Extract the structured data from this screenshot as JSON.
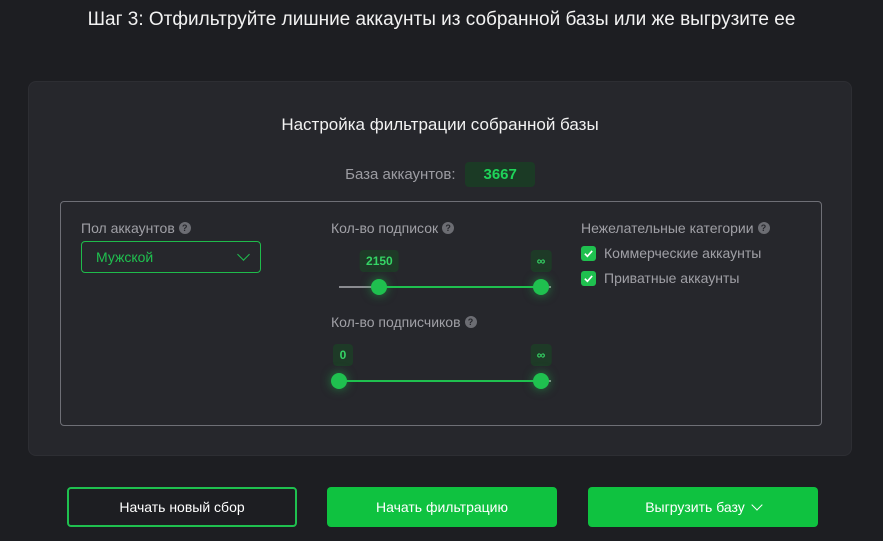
{
  "step_title": "Шаг 3: Отфильтруйте лишние аккаунты из собранной базы или же выгрузите ее",
  "card": {
    "title": "Настройка фильтрации собранной базы",
    "base_label": "База аккаунтов:",
    "base_count": "3667"
  },
  "filters": {
    "gender": {
      "label": "Пол аккаунтов",
      "help": "?",
      "selected": "Мужской"
    },
    "following": {
      "label": "Кол-во подписок",
      "help": "?",
      "min": "2150",
      "max": "∞",
      "min_pos": 0.2,
      "max_pos": 1.0
    },
    "followers": {
      "label": "Кол-во подписчиков",
      "help": "?",
      "min": "0",
      "max": "∞",
      "min_pos": 0.0,
      "max_pos": 1.0
    },
    "unwanted": {
      "label": "Нежелательные категории",
      "help": "?",
      "items": [
        {
          "label": "Коммерческие аккаунты",
          "checked": true
        },
        {
          "label": "Приватные аккаунты",
          "checked": true
        }
      ]
    }
  },
  "buttons": {
    "new_collection": "Начать новый сбор",
    "start_filter": "Начать фильтрацию",
    "export": "Выгрузить базу"
  },
  "colors": {
    "accent": "#1fc04f",
    "background": "#1d1e22",
    "card": "#26272c"
  }
}
